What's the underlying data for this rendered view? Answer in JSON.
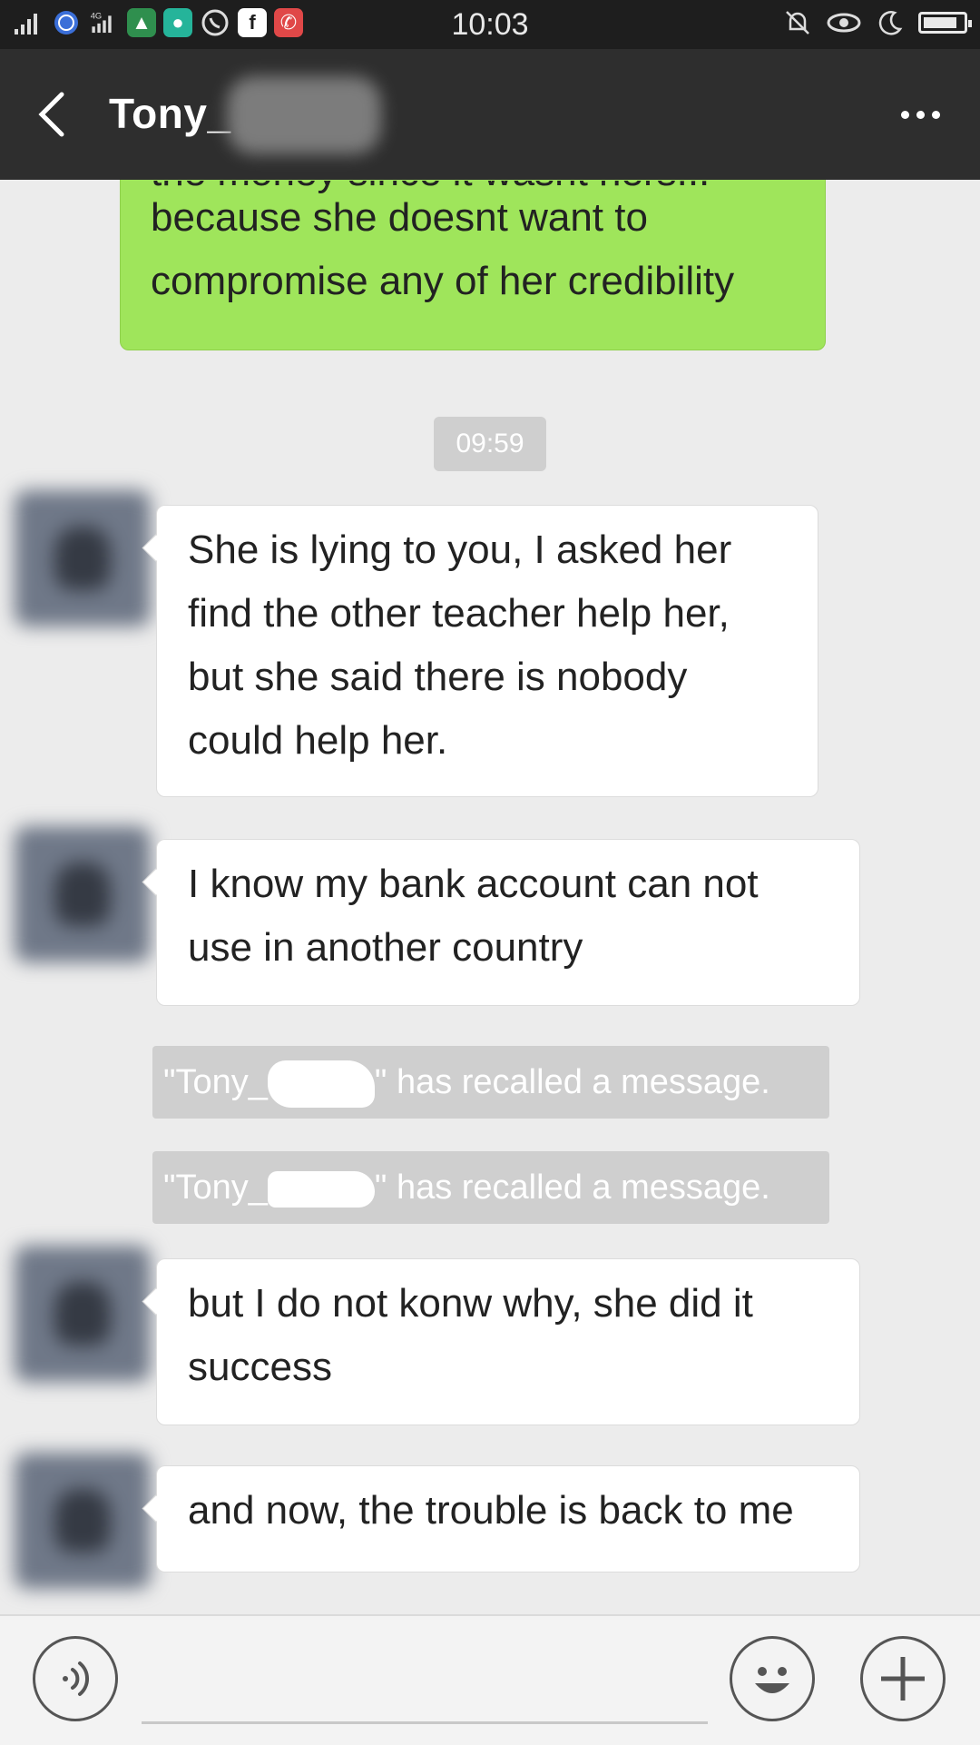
{
  "status_bar": {
    "time": "10:03",
    "network": "4G",
    "icons": [
      "signal-icon",
      "signal-4g-icon",
      "app-icon",
      "app-icon",
      "whatsapp-icon",
      "facebook-icon",
      "phone-icon",
      "mute-icon",
      "eye-icon",
      "moon-icon",
      "battery-icon"
    ],
    "battery_level": 0.75
  },
  "header": {
    "title": "Tony_",
    "back_icon": "chevron-left-icon",
    "more_icon": "more-icon"
  },
  "messages": {
    "sent_partial": {
      "cut_line": "the money since it wasnt hers...",
      "lines": [
        "because she doesnt want to",
        "compromise any of her credibility"
      ]
    },
    "timestamp": "09:59",
    "recv_1": {
      "lines": [
        "She is lying to you,  I asked her",
        "find the other teacher help her,",
        "but she said there is nobody",
        "could help her."
      ]
    },
    "recv_2": {
      "lines": [
        "I know my bank account can not",
        "use in another country"
      ]
    },
    "recall_1": {
      "prefix": "\"Tony_",
      "suffix": "\" has recalled a message."
    },
    "recall_2": {
      "prefix": "\"Tony_",
      "suffix": "\" has recalled a message."
    },
    "recv_3": {
      "lines": [
        "but I do not konw why, she did it",
        "success"
      ]
    },
    "recv_4": {
      "lines": [
        "and now, the trouble is back to me"
      ]
    }
  },
  "input_bar": {
    "voice_icon": "voice-icon",
    "emoji_icon": "emoji-icon",
    "plus_icon": "plus-icon",
    "placeholder": ""
  },
  "colors": {
    "sent_bubble": "#9fe55b",
    "header_bg": "#2e2e2e",
    "status_bg": "#1e1e1e",
    "chat_bg": "#ececec"
  }
}
